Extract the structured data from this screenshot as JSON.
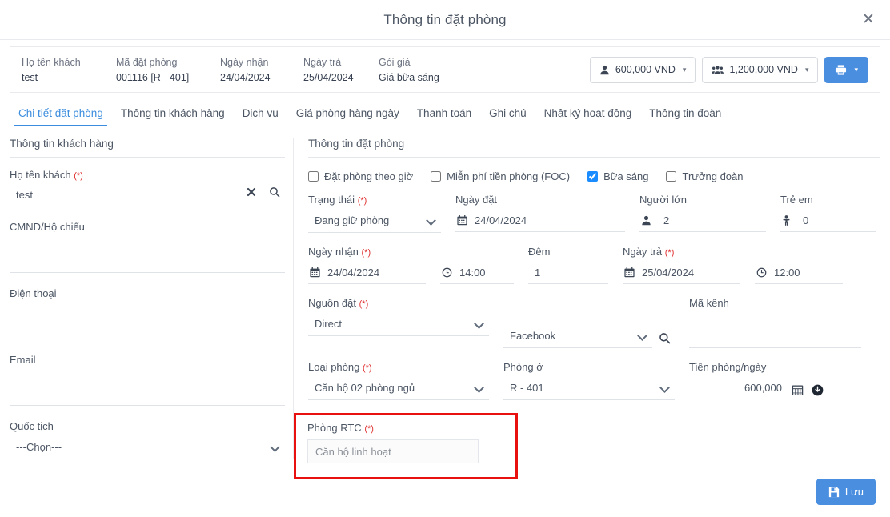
{
  "header": {
    "title": "Thông tin đặt phòng",
    "close_icon": "close-icon"
  },
  "summary": {
    "fields": [
      {
        "label": "Họ tên khách",
        "value": "test"
      },
      {
        "label": "Mã đặt phòng",
        "value": "001116 [R - 401]"
      },
      {
        "label": "Ngày nhận",
        "value": "24/04/2024"
      },
      {
        "label": "Ngày trả",
        "value": "25/04/2024"
      },
      {
        "label": "Gói giá",
        "value": "Giá bữa sáng"
      }
    ],
    "room_price_pill": {
      "icon": "user-icon",
      "value": "600,000 VND",
      "caret": "▾"
    },
    "group_price_pill": {
      "icon": "users-group-icon",
      "value": "1,200,000 VND",
      "caret": "▾"
    },
    "print_button": {
      "icon": "printer-icon",
      "caret": "▾"
    }
  },
  "tabs": [
    {
      "label": "Chi tiết đặt phòng",
      "active": true
    },
    {
      "label": "Thông tin khách hàng",
      "active": false
    },
    {
      "label": "Dịch vụ",
      "active": false
    },
    {
      "label": "Giá phòng hàng ngày",
      "active": false
    },
    {
      "label": "Thanh toán",
      "active": false
    },
    {
      "label": "Ghi chú",
      "active": false
    },
    {
      "label": "Nhật ký hoạt động",
      "active": false
    },
    {
      "label": "Thông tin đoàn",
      "active": false
    }
  ],
  "customer": {
    "section_title": "Thông tin khách hàng",
    "name": {
      "label": "Họ tên khách",
      "required": "(*)",
      "value": "test",
      "placeholder": ""
    },
    "id_number": {
      "label": "CMND/Hộ chiếu",
      "value": "",
      "placeholder": ""
    },
    "phone": {
      "label": "Điện thoại",
      "value": "",
      "placeholder": ""
    },
    "email": {
      "label": "Email",
      "value": "",
      "placeholder": ""
    },
    "nationality": {
      "label": "Quốc tịch",
      "value": "---Chọn---",
      "options": [
        "---Chọn---"
      ]
    }
  },
  "booking": {
    "section_title": "Thông tin đặt phòng",
    "checkboxes": [
      {
        "label": "Đặt phòng theo giờ",
        "checked": false
      },
      {
        "label": "Miễn phí tiền phòng (FOC)",
        "checked": false
      },
      {
        "label": "Bữa sáng",
        "checked": true
      },
      {
        "label": "Trưởng đoàn",
        "checked": false
      }
    ],
    "status": {
      "label": "Trạng thái",
      "required": "(*)",
      "value": "Đang giữ phòng",
      "options": [
        "Đang giữ phòng"
      ]
    },
    "booking_date": {
      "label": "Ngày đặt",
      "value": "24/04/2024",
      "icon": "calendar-icon"
    },
    "adults": {
      "label": "Người lớn",
      "value": "2",
      "icon": "adult-icon"
    },
    "children": {
      "label": "Trẻ em",
      "value": "0",
      "icon": "child-icon"
    },
    "checkin_date": {
      "label": "Ngày nhận",
      "required": "(*)",
      "value": "24/04/2024",
      "icon": "calendar-icon"
    },
    "checkin_time": {
      "value": "14:00",
      "icon": "clock-icon"
    },
    "nights": {
      "label": "Đêm",
      "value": "1"
    },
    "checkout_date": {
      "label": "Ngày trả",
      "required": "(*)",
      "value": "25/04/2024",
      "icon": "calendar-icon"
    },
    "checkout_time": {
      "value": "12:00",
      "icon": "clock-icon"
    },
    "source": {
      "label": "Nguồn đặt",
      "required": "(*)",
      "value": "Direct",
      "options": [
        "Direct"
      ]
    },
    "source_sub": {
      "value": "Facebook",
      "options": [
        "Facebook"
      ],
      "search_icon": "search-icon"
    },
    "channel_code": {
      "label": "Mã kênh",
      "value": "",
      "placeholder": ""
    },
    "room_type": {
      "label": "Loại phòng",
      "required": "(*)",
      "value": "Căn hộ 02 phòng ngủ",
      "options": [
        "Căn hộ 02 phòng ngủ"
      ]
    },
    "room": {
      "label": "Phòng ở",
      "value": "R - 401",
      "options": [
        "R - 401"
      ]
    },
    "price_per_day": {
      "label": "Tiền phòng/ngày",
      "value": "600,000",
      "calc_icon": "calculator-icon",
      "history_icon": "history-icon"
    },
    "rtc_room": {
      "label": "Phòng RTC",
      "required": "(*)",
      "value": "",
      "placeholder": "Căn hộ linh hoạt",
      "highlight_color": "#e8110f"
    }
  },
  "footer": {
    "save_label": "Lưu",
    "save_icon": "save-icon"
  },
  "colors": {
    "accent": "#4a8ee0",
    "tab_active": "#3c8dde",
    "required": "#e03131",
    "highlight": "#e8110f",
    "checkbox_checked": "#1a8cff"
  }
}
